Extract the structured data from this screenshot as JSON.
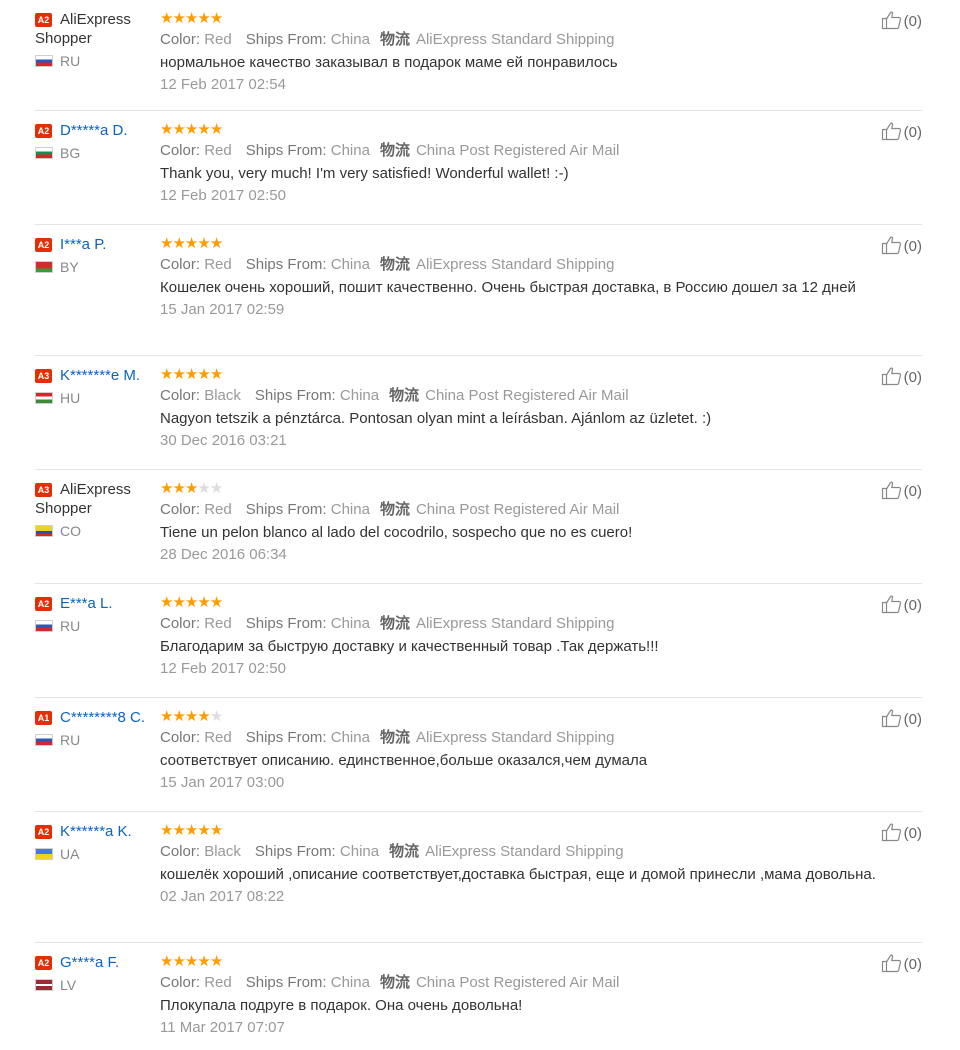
{
  "labels": {
    "color": "Color:",
    "ships_from": "Ships From:",
    "logistics_icon": "物流"
  },
  "reviews": [
    {
      "badge": "A2",
      "name": "AliExpress Shopper",
      "country": "RU",
      "flag": "ru",
      "stars": 5,
      "color": "Red",
      "ships_from": "China",
      "shipping": "AliExpress Standard Shipping",
      "text": "нормальное качество заказывал в подарок маме ей понравилось",
      "date": "12 Feb 2017 02:54",
      "helpful": "(0)"
    },
    {
      "badge": "A2",
      "name": "D*****a D.",
      "country": "BG",
      "flag": "bg",
      "stars": 5,
      "color": "Red",
      "ships_from": "China",
      "shipping": "China Post Registered Air Mail",
      "text": "Thank you, very much! I'm very satisfied! Wonderful wallet! :-)",
      "date": "12 Feb 2017 02:50",
      "helpful": "(0)"
    },
    {
      "badge": "A2",
      "name": "I***a P.",
      "country": "BY",
      "flag": "by",
      "stars": 5,
      "color": "Red",
      "ships_from": "China",
      "shipping": "AliExpress Standard Shipping",
      "text": "Кошелек очень хороший, пошит качественно. Очень быстрая доставка, в Россию дошел за 12 дней",
      "date": "15 Jan 2017 02:59",
      "helpful": "(0)"
    },
    {
      "badge": "A3",
      "name": "K*******e M.",
      "country": "HU",
      "flag": "hu",
      "stars": 5,
      "color": "Black",
      "ships_from": "China",
      "shipping": "China Post Registered Air Mail",
      "text": "Nagyon tetszik a pénztárca. Pontosan olyan mint a leírásban. Ajánlom az üzletet. :)",
      "date": "30 Dec 2016 03:21",
      "helpful": "(0)"
    },
    {
      "badge": "A3",
      "name": "AliExpress Shopper",
      "country": "CO",
      "flag": "co",
      "stars": 3,
      "color": "Red",
      "ships_from": "China",
      "shipping": "China Post Registered Air Mail",
      "text": "Tiene un pelon blanco al lado del cocodrilo, sospecho que no es cuero!",
      "date": "28 Dec 2016 06:34",
      "helpful": "(0)"
    },
    {
      "badge": "A2",
      "name": "E***a L.",
      "country": "RU",
      "flag": "ru",
      "stars": 5,
      "color": "Red",
      "ships_from": "China",
      "shipping": "AliExpress Standard Shipping",
      "text": "Благодарим за быструю доставку и качественный товар .Так держать!!!",
      "date": "12 Feb 2017 02:50",
      "helpful": "(0)"
    },
    {
      "badge": "A1",
      "name": "C********8 C.",
      "country": "RU",
      "flag": "ru",
      "stars": 4,
      "color": "Red",
      "ships_from": "China",
      "shipping": "AliExpress Standard Shipping",
      "text": "соответствует описанию. единственное,больше оказался,чем думала",
      "date": "15 Jan 2017 03:00",
      "helpful": "(0)"
    },
    {
      "badge": "A2",
      "name": "K******a K.",
      "country": "UA",
      "flag": "ua",
      "stars": 5,
      "color": "Black",
      "ships_from": "China",
      "shipping": "AliExpress Standard Shipping",
      "text": "кошелёк хороший ,описание соответствует,доставка быстрая, еще и домой принесли ,мама довольна.",
      "date": "02 Jan 2017 08:22",
      "helpful": "(0)"
    },
    {
      "badge": "A2",
      "name": "G****a F.",
      "country": "LV",
      "flag": "lv",
      "stars": 5,
      "color": "Red",
      "ships_from": "China",
      "shipping": "China Post Registered Air Mail",
      "text": "Плокупала подруге в подарок. Она очень довольна!",
      "date": "11 Mar 2017 07:07",
      "helpful": "(0)"
    }
  ]
}
